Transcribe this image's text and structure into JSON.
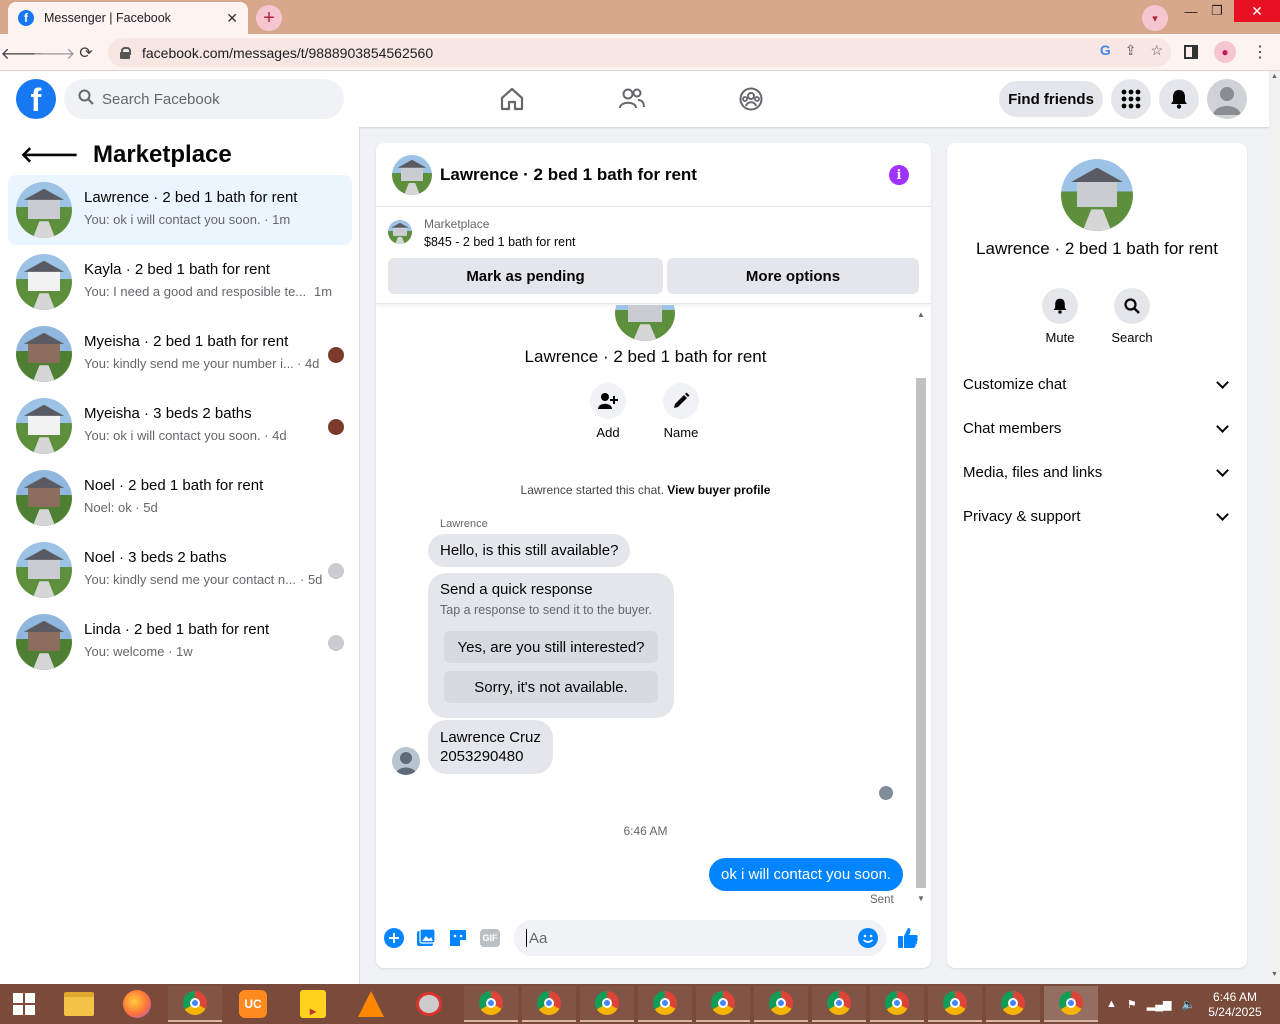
{
  "browser": {
    "tab_title": "Messenger | Facebook",
    "url": "facebook.com/messages/t/9888903854562560"
  },
  "header": {
    "search_placeholder": "Search Facebook",
    "find_friends": "Find friends"
  },
  "sidebar": {
    "title": "Marketplace",
    "conversations": [
      {
        "name": "Lawrence · 2 bed 1 bath for rent",
        "snippet": "You: ok i will contact you soon. · 1m",
        "active": true
      },
      {
        "name": "Kayla · 2 bed 1 bath for rent",
        "snippet": "You: I need a good and resposible te...",
        "time": "1m"
      },
      {
        "name": "Myeisha · 2 bed 1 bath for rent",
        "snippet": "You: kindly send me your number i...",
        "time": "· 4d"
      },
      {
        "name": "Myeisha · 3 beds 2 baths",
        "snippet": "You: ok i will contact you soon. · 4d"
      },
      {
        "name": "Noel · 2 bed 1 bath for rent",
        "snippet": "Noel: ok · 5d"
      },
      {
        "name": "Noel · 3 beds 2 baths",
        "snippet": "You: kindly send me your contact n...",
        "time": "· 5d"
      },
      {
        "name": "Linda · 2 bed 1 bath for rent",
        "snippet": "You: welcome · 1w"
      }
    ]
  },
  "chat": {
    "title": "Lawrence · 2 bed 1 bath for rent",
    "listing_category": "Marketplace",
    "listing_title": "$845 - 2 bed 1 bath for rent",
    "mark_pending": "Mark as pending",
    "more_options": "More options",
    "profile_title": "Lawrence · 2 bed 1 bath for rent",
    "add_label": "Add",
    "name_label": "Name",
    "started_text": "Lawrence started this chat.",
    "view_profile": "View buyer profile",
    "sender_name": "Lawrence",
    "msg_first": "Hello, is this still available?",
    "quick_title": "Send a quick response",
    "quick_sub": "Tap a response to send it to the buyer.",
    "quick_opt1": "Yes, are you still interested?",
    "quick_opt2": "Sorry, it's not available.",
    "contact_name": "Lawrence Cruz",
    "contact_number": "2053290480",
    "timestamp": "6:46 AM",
    "my_msg": "ok i will contact you soon.",
    "sent_label": "Sent",
    "composer_placeholder": "Aa"
  },
  "right_panel": {
    "title": "Lawrence · 2 bed 1 bath for rent",
    "mute": "Mute",
    "search": "Search",
    "sections": [
      "Customize chat",
      "Chat members",
      "Media, files and links",
      "Privacy & support"
    ]
  },
  "taskbar": {
    "time": "6:46 AM",
    "date": "5/24/2025"
  },
  "colors": {
    "fb_blue": "#1877f2",
    "messenger_bubble": "#0084ff",
    "info_purple": "#a033ff"
  }
}
